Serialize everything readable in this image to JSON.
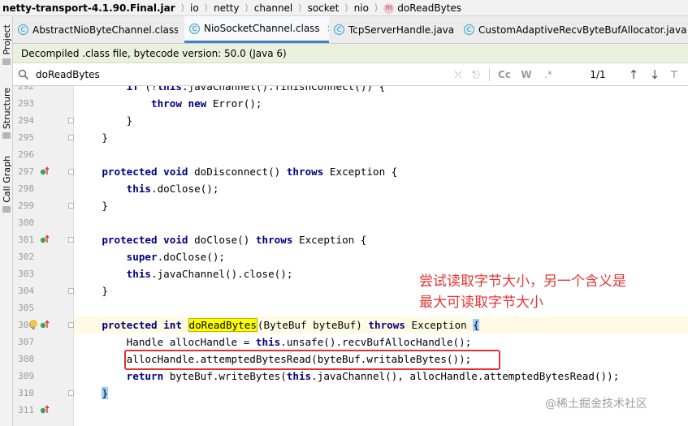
{
  "breadcrumb": {
    "items": [
      "netty-transport-4.1.90.Final.jar",
      "io",
      "netty",
      "channel",
      "socket",
      "nio",
      "doReadBytes"
    ],
    "method_badge": "m"
  },
  "tool_strip": {
    "tabs": [
      "Project",
      "Structure",
      "Call Graph"
    ]
  },
  "tabs": [
    {
      "label": "AbstractNioByteChannel.class",
      "icon": "C",
      "close": "×"
    },
    {
      "label": "NioSocketChannel.class",
      "icon": "C",
      "close": "×"
    },
    {
      "label": "TcpServerHandle.java",
      "icon": "C",
      "close": "×"
    },
    {
      "label": "CustomAdaptiveRecvByteBufAllocator.java",
      "icon": "C",
      "close": "×"
    }
  ],
  "banner": {
    "text": "Decompiled .class file, bytecode version: 50.0 (Java 6)"
  },
  "find": {
    "value": "doReadBytes",
    "clear": "⤫",
    "history": "⎋",
    "match_case": "Cc",
    "whole_word": "W",
    "regex": ".*",
    "count": "1/1",
    "prev": "↑",
    "next": "↓",
    "filter": "⊤"
  },
  "editor": {
    "line_numbers": [
      "292",
      "293",
      "294",
      "295",
      "296",
      "297",
      "298",
      "299",
      "300",
      "301",
      "302",
      "303",
      "304",
      "305",
      "306",
      "307",
      "308",
      "309",
      "310",
      "311"
    ],
    "lines": [
      {
        "parts": [
          [
            "",
            "        "
          ],
          [
            "kw",
            "if"
          ],
          [
            "",
            " (!"
          ],
          [
            "kw",
            "this"
          ],
          [
            "",
            ".javaChannel().finishConnect()) {"
          ]
        ]
      },
      {
        "parts": [
          [
            "",
            "            "
          ],
          [
            "kw",
            "throw new"
          ],
          [
            "",
            " Error();"
          ]
        ]
      },
      {
        "parts": [
          [
            "",
            "        }"
          ]
        ]
      },
      {
        "parts": [
          [
            "",
            "    }"
          ]
        ]
      },
      {
        "parts": [
          [
            "",
            ""
          ]
        ]
      },
      {
        "parts": [
          [
            "",
            "    "
          ],
          [
            "kw",
            "protected void"
          ],
          [
            "",
            " doDisconnect() "
          ],
          [
            "kw",
            "throws"
          ],
          [
            "",
            " Exception {"
          ]
        ]
      },
      {
        "parts": [
          [
            "",
            "        "
          ],
          [
            "kw",
            "this"
          ],
          [
            "",
            ".doClose();"
          ]
        ]
      },
      {
        "parts": [
          [
            "",
            "    }"
          ]
        ]
      },
      {
        "parts": [
          [
            "",
            ""
          ]
        ]
      },
      {
        "parts": [
          [
            "",
            "    "
          ],
          [
            "kw",
            "protected void"
          ],
          [
            "",
            " doClose() "
          ],
          [
            "kw",
            "throws"
          ],
          [
            "",
            " Exception {"
          ]
        ]
      },
      {
        "parts": [
          [
            "",
            "        "
          ],
          [
            "kw",
            "super"
          ],
          [
            "",
            ".doClose();"
          ]
        ]
      },
      {
        "parts": [
          [
            "",
            "        "
          ],
          [
            "kw",
            "this"
          ],
          [
            "",
            ".javaChannel().close();"
          ]
        ]
      },
      {
        "parts": [
          [
            "",
            "    }"
          ]
        ]
      },
      {
        "parts": [
          [
            "",
            ""
          ]
        ]
      },
      {
        "parts": [
          [
            "",
            "    "
          ],
          [
            "kw",
            "protected int"
          ],
          [
            "",
            " "
          ],
          [
            "hl",
            "doReadBytes"
          ],
          [
            "",
            "(ByteBuf byteBuf) "
          ],
          [
            "kw",
            "throws"
          ],
          [
            "",
            " Exception "
          ],
          [
            "brace-hl",
            "{"
          ]
        ]
      },
      {
        "parts": [
          [
            "",
            "        Handle allocHandle = "
          ],
          [
            "kw",
            "this"
          ],
          [
            "",
            ".unsafe().recvBufAllocHandle();"
          ]
        ]
      },
      {
        "parts": [
          [
            "",
            "        allocHandle.attemptedBytesRead(byteBuf.writableBytes());"
          ]
        ]
      },
      {
        "parts": [
          [
            "",
            "        "
          ],
          [
            "kw",
            "return"
          ],
          [
            "",
            " byteBuf.writeBytes("
          ],
          [
            "kw",
            "this"
          ],
          [
            "",
            ".javaChannel(), allocHandle.attemptedBytesRead());"
          ]
        ]
      },
      {
        "parts": [
          [
            "",
            "    "
          ],
          [
            "brace-hl",
            "}"
          ]
        ]
      },
      {
        "parts": [
          [
            "",
            ""
          ]
        ]
      }
    ],
    "override_marker_lines": [
      5,
      9,
      14,
      19
    ]
  },
  "annotation": {
    "lines": [
      "尝试读取字节大小，另一个含义是",
      "最大可读取字节大小"
    ],
    "color": "#e53535"
  },
  "watermark": "@稀土掘金技术社区"
}
